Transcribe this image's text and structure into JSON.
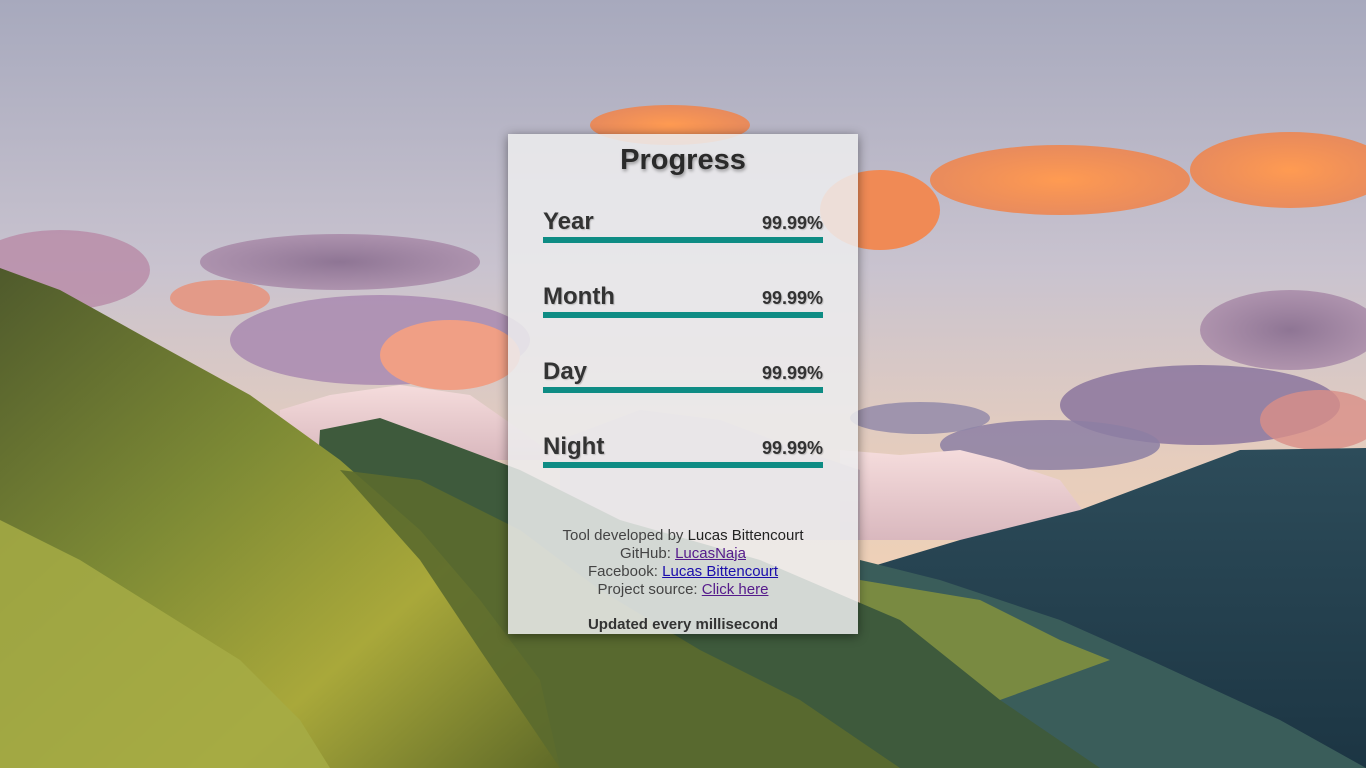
{
  "title": "Progress",
  "rows": [
    {
      "label": "Year",
      "percent_text": "99.99%",
      "progress": 0.9999
    },
    {
      "label": "Month",
      "percent_text": "99.99%",
      "progress": 0.9999
    },
    {
      "label": "Day",
      "percent_text": "99.99%",
      "progress": 0.9999
    },
    {
      "label": "Night",
      "percent_text": "99.99%",
      "progress": 0.9999
    }
  ],
  "footer": {
    "developed_prefix": "Tool developed by",
    "developer_name": "Lucas Bittencourt",
    "github_label": "GitHub:",
    "github_link": "LucasNaja",
    "facebook_label": "Facebook:",
    "facebook_link": "Lucas Bittencourt",
    "source_label": "Project source:",
    "source_link": "Click here",
    "updated_text": "Updated every millisecond"
  },
  "colors": {
    "bar_fill": "#0e8c84",
    "link": "#1a0dab",
    "link_visited": "#551a8b"
  }
}
